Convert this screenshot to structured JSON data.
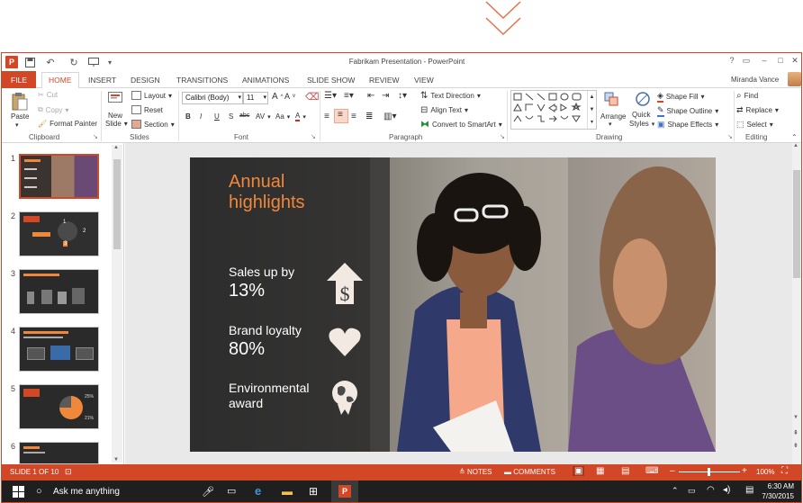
{
  "window": {
    "title": "Fabrikam Presentation - PowerPoint",
    "help": "?",
    "user": "Miranda Vance"
  },
  "tabs": [
    "FILE",
    "HOME",
    "INSERT",
    "DESIGN",
    "TRANSITIONS",
    "ANIMATIONS",
    "SLIDE SHOW",
    "REVIEW",
    "VIEW"
  ],
  "ribbon": {
    "clipboard": {
      "paste": "Paste",
      "cut": "Cut",
      "copy": "Copy",
      "format_painter": "Format Painter",
      "label": "Clipboard"
    },
    "slides": {
      "new_slide_line1": "New",
      "new_slide_line2": "Slide",
      "layout": "Layout",
      "reset": "Reset",
      "section": "Section",
      "label": "Slides"
    },
    "font": {
      "family": "Calibri (Body)",
      "size": "11",
      "bold": "B",
      "italic": "I",
      "underline": "U",
      "strike": "S",
      "shadow": "abc",
      "spacing": "AV",
      "case": "Aa",
      "color": "A",
      "label": "Font"
    },
    "paragraph": {
      "text_direction": "Text Direction",
      "align_text": "Align Text",
      "smartart": "Convert to SmartArt",
      "label": "Paragraph"
    },
    "drawing": {
      "arrange": "Arrange",
      "quick_styles_line1": "Quick",
      "quick_styles_line2": "Styles",
      "shape_fill": "Shape Fill",
      "shape_outline": "Shape Outline",
      "shape_effects": "Shape Effects",
      "label": "Drawing"
    },
    "editing": {
      "find": "Find",
      "replace": "Replace",
      "select": "Select",
      "label": "Editing"
    }
  },
  "thumbnails": [
    "1",
    "2",
    "3",
    "4",
    "5",
    "6"
  ],
  "slide": {
    "title_line1": "Annual",
    "title_line2": "highlights",
    "item1_label": "Sales up by",
    "item1_value": "13%",
    "item2_label": "Brand loyalty",
    "item2_value": "80%",
    "item3_label1": "Environmental",
    "item3_label2": "award"
  },
  "thumb_texts": {
    "t2_a": "1",
    "t2_b": "2",
    "t2_c": "3",
    "t5_a": "25%",
    "t5_b": "21%"
  },
  "status": {
    "slide": "SLIDE 1 OF 10",
    "notes": "NOTES",
    "comments": "COMMENTS",
    "zoom": "100%"
  },
  "taskbar": {
    "search": "Ask me anything",
    "time": "6:30 AM",
    "date": "7/30/2015"
  },
  "colors": {
    "accent": "#d24726",
    "slide_orange": "#f0883c"
  }
}
